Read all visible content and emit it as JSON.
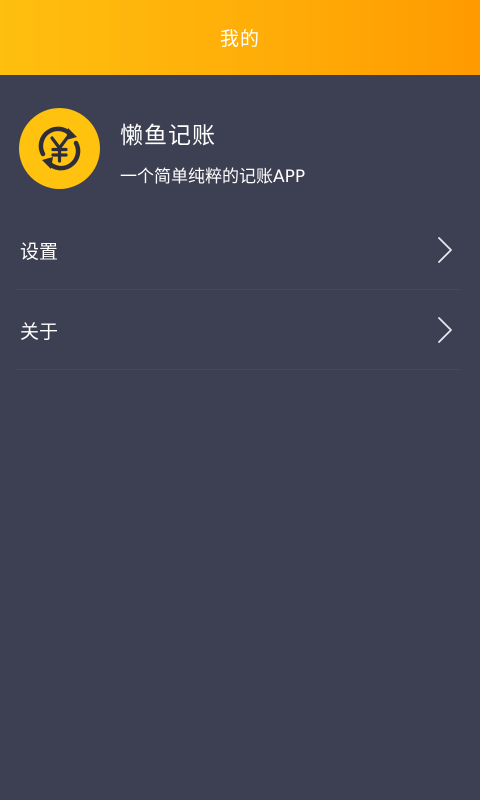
{
  "header": {
    "title": "我的"
  },
  "profile": {
    "icon": "yuan-exchange-icon",
    "app_name": "懒鱼记账",
    "description": "一个简单纯粹的记账APP"
  },
  "menu": {
    "items": [
      {
        "label": "设置",
        "icon": "chevron-right-icon"
      },
      {
        "label": "关于",
        "icon": "chevron-right-icon"
      }
    ]
  },
  "colors": {
    "header_gradient_start": "#ffbf0f",
    "header_gradient_end": "#ff9a00",
    "background": "#3d3f52",
    "logo_yellow": "#ffc20e",
    "text": "#ffffff"
  }
}
